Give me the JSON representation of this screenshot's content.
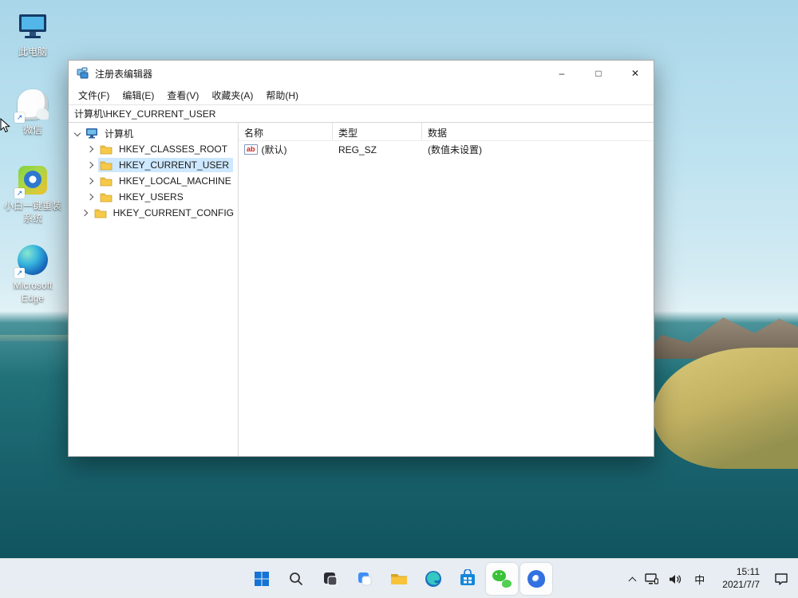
{
  "colors": {
    "accent": "#0078d4",
    "tree_selection": "#cde8ff",
    "taskbar_bg": "#f3f6fa",
    "water": "#175f6a"
  },
  "desktop": {
    "icons": [
      {
        "label": "此电脑",
        "shortcut": false
      },
      {
        "label": "微信",
        "shortcut": true
      },
      {
        "label": "小白一键重装系统",
        "shortcut": true
      },
      {
        "label": "Microsoft Edge",
        "shortcut": true
      }
    ]
  },
  "window": {
    "title": "注册表编辑器",
    "controls": {
      "minimize": "–",
      "maximize": "□",
      "close": "✕"
    },
    "menu": [
      "文件(F)",
      "编辑(E)",
      "查看(V)",
      "收藏夹(A)",
      "帮助(H)"
    ],
    "address": "计算机\\HKEY_CURRENT_USER",
    "tree": {
      "root": "计算机",
      "selected": "HKEY_CURRENT_USER",
      "items": [
        {
          "label": "HKEY_CLASSES_ROOT",
          "selected": false
        },
        {
          "label": "HKEY_CURRENT_USER",
          "selected": true
        },
        {
          "label": "HKEY_LOCAL_MACHINE",
          "selected": false
        },
        {
          "label": "HKEY_USERS",
          "selected": false
        },
        {
          "label": "HKEY_CURRENT_CONFIG",
          "selected": false
        }
      ]
    },
    "list": {
      "columns": [
        "名称",
        "类型",
        "数据"
      ],
      "rows": [
        {
          "icon": "ab",
          "name": "(默认)",
          "type": "REG_SZ",
          "data": "(数值未设置)"
        }
      ]
    }
  },
  "taskbar": {
    "tray": {
      "input_method": "中",
      "time": "15:11",
      "date": "2021/7/7"
    }
  },
  "glyphs": {
    "shortcut_arrow": "↗",
    "ab_badge": "ab"
  }
}
